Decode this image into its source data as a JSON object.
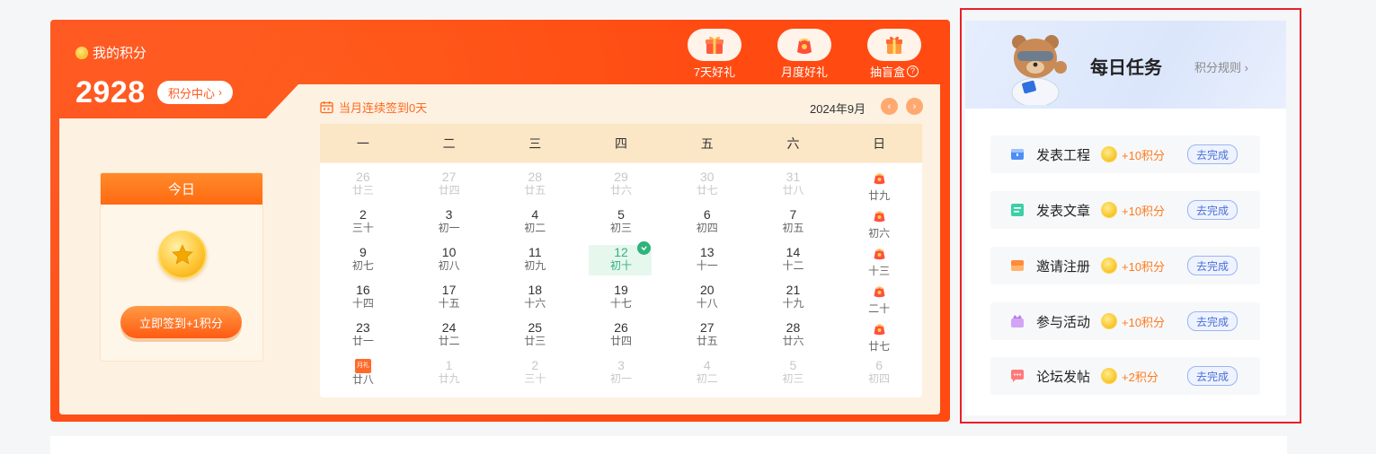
{
  "points": {
    "label": "我的积分",
    "value": "2928",
    "center_label": "积分中心",
    "gifts": [
      {
        "label": "7天好礼",
        "icon": "gift-box-icon"
      },
      {
        "label": "月度好礼",
        "icon": "red-bag-icon"
      },
      {
        "label": "抽盲盒",
        "icon": "blind-box-icon",
        "help": "?"
      }
    ]
  },
  "today": {
    "title": "今日",
    "button_label": "立即签到+1积分"
  },
  "calendar": {
    "streak_label": "当月连续签到0天",
    "month_label": "2024年9月",
    "prev": "‹",
    "next": "›",
    "weekdays": [
      "一",
      "二",
      "三",
      "四",
      "五",
      "六",
      "日"
    ],
    "weeks": [
      [
        {
          "day": "26",
          "lunar": "廿三",
          "dim": true
        },
        {
          "day": "27",
          "lunar": "廿四",
          "dim": true
        },
        {
          "day": "28",
          "lunar": "廿五",
          "dim": true
        },
        {
          "day": "29",
          "lunar": "廿六",
          "dim": true
        },
        {
          "day": "30",
          "lunar": "廿七",
          "dim": true
        },
        {
          "day": "31",
          "lunar": "廿八",
          "dim": true
        },
        {
          "day": "",
          "lunar": "廿九",
          "gift": true
        }
      ],
      [
        {
          "day": "2",
          "lunar": "三十"
        },
        {
          "day": "3",
          "lunar": "初一"
        },
        {
          "day": "4",
          "lunar": "初二"
        },
        {
          "day": "5",
          "lunar": "初三"
        },
        {
          "day": "6",
          "lunar": "初四"
        },
        {
          "day": "7",
          "lunar": "初五"
        },
        {
          "day": "",
          "lunar": "初六",
          "gift": true
        }
      ],
      [
        {
          "day": "9",
          "lunar": "初七"
        },
        {
          "day": "10",
          "lunar": "初八"
        },
        {
          "day": "11",
          "lunar": "初九"
        },
        {
          "day": "12",
          "lunar": "初十",
          "today": true
        },
        {
          "day": "13",
          "lunar": "十一"
        },
        {
          "day": "14",
          "lunar": "十二"
        },
        {
          "day": "",
          "lunar": "十三",
          "gift": true
        }
      ],
      [
        {
          "day": "16",
          "lunar": "十四"
        },
        {
          "day": "17",
          "lunar": "十五"
        },
        {
          "day": "18",
          "lunar": "十六"
        },
        {
          "day": "19",
          "lunar": "十七"
        },
        {
          "day": "20",
          "lunar": "十八"
        },
        {
          "day": "21",
          "lunar": "十九"
        },
        {
          "day": "",
          "lunar": "二十",
          "gift": true
        }
      ],
      [
        {
          "day": "23",
          "lunar": "廿一"
        },
        {
          "day": "24",
          "lunar": "廿二"
        },
        {
          "day": "25",
          "lunar": "廿三"
        },
        {
          "day": "26",
          "lunar": "廿四"
        },
        {
          "day": "27",
          "lunar": "廿五"
        },
        {
          "day": "28",
          "lunar": "廿六"
        },
        {
          "day": "",
          "lunar": "廿七",
          "gift": true
        }
      ],
      [
        {
          "day": "",
          "lunar": "廿八",
          "month_gift": true,
          "month_gift_text": "月礼"
        },
        {
          "day": "1",
          "lunar": "廿九",
          "dim": true
        },
        {
          "day": "2",
          "lunar": "三十",
          "dim": true
        },
        {
          "day": "3",
          "lunar": "初一",
          "dim": true
        },
        {
          "day": "4",
          "lunar": "初二",
          "dim": true
        },
        {
          "day": "5",
          "lunar": "初三",
          "dim": true
        },
        {
          "day": "6",
          "lunar": "初四",
          "dim": true
        }
      ]
    ]
  },
  "tasks": {
    "title": "每日任务",
    "rules_label": "积分规则",
    "items": [
      {
        "name": "发表工程",
        "points": "+10积分",
        "action": "去完成",
        "icon": "project-icon",
        "color": "#4d8ef7"
      },
      {
        "name": "发表文章",
        "points": "+10积分",
        "action": "去完成",
        "icon": "article-icon",
        "color": "#3ccfa8"
      },
      {
        "name": "邀请注册",
        "points": "+10积分",
        "action": "去完成",
        "icon": "invite-icon",
        "color": "#ff9a4a"
      },
      {
        "name": "参与活动",
        "points": "+10积分",
        "action": "去完成",
        "icon": "activity-icon",
        "color": "#c58cf2"
      },
      {
        "name": "论坛发帖",
        "points": "+2积分",
        "action": "去完成",
        "icon": "forum-icon",
        "color": "#ff7a7a"
      }
    ]
  },
  "colors": {
    "brand_orange": "#ff4a12",
    "cream": "#fdf1e2",
    "today_green": "#2fb37d",
    "highlight_border": "#e8202a"
  }
}
